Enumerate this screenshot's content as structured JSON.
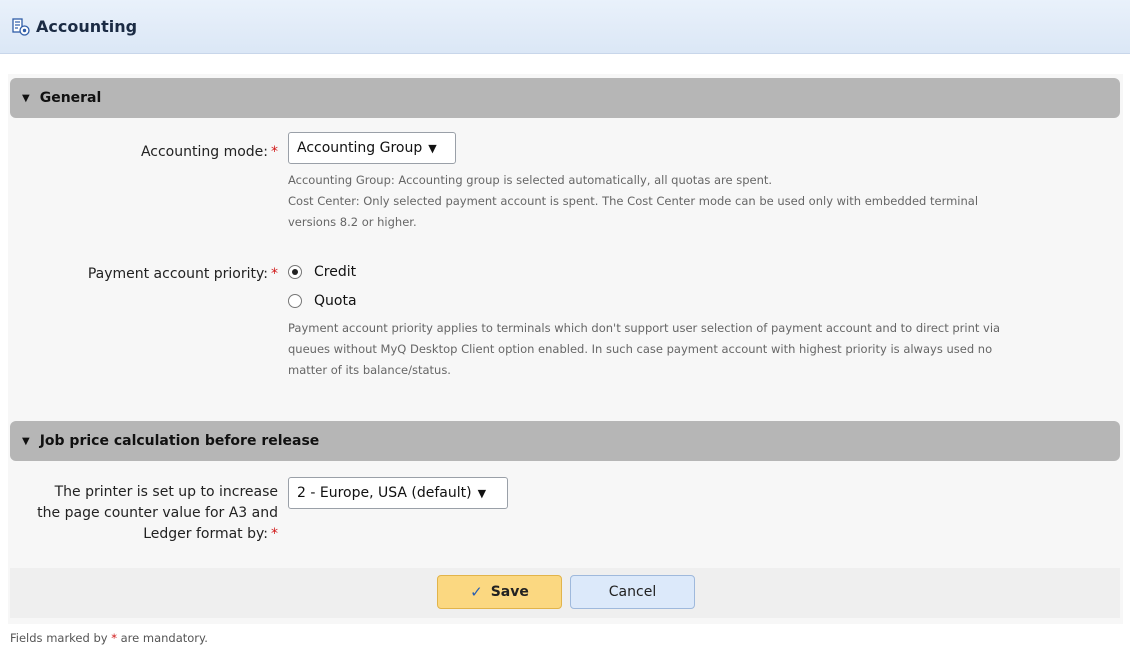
{
  "window": {
    "title": "Accounting",
    "icon": "accounting-icon"
  },
  "sections": {
    "general": {
      "header": "General",
      "accounting_mode": {
        "label": "Accounting mode:",
        "required_mark": "*",
        "selected": "Accounting Group",
        "help_line1": "Accounting Group: Accounting group is selected automatically, all quotas are spent.",
        "help_line2": "Cost Center: Only selected payment account is spent. The Cost Center mode can be used only with embedded terminal",
        "help_line3": "versions 8.2 or higher."
      },
      "payment_priority": {
        "label": "Payment account priority:",
        "required_mark": "*",
        "options": [
          "Credit",
          "Quota"
        ],
        "selected_index": 0,
        "help_line1": "Payment account priority applies to terminals which don't support user selection of payment account and to direct print via",
        "help_line2": "queues without MyQ Desktop Client option enabled. In such case payment account with highest priority is always used no",
        "help_line3": "matter of its balance/status."
      }
    },
    "job_price": {
      "header": "Job price calculation before release",
      "counter": {
        "label_line1": "The printer is set up to increase",
        "label_line2": "the page counter value for A3 and",
        "label_line3": "Ledger format by:",
        "required_mark": "*",
        "selected": "2 - Europe, USA (default)"
      }
    }
  },
  "buttons": {
    "save": "Save",
    "cancel": "Cancel"
  },
  "footer": {
    "prefix": "Fields marked by",
    "mark": "*",
    "suffix": "are mandatory."
  },
  "colors": {
    "section_header": "#b6b6b6",
    "save_button": "#fbd881",
    "cancel_button": "#dce9fa",
    "required": "#d01818"
  }
}
